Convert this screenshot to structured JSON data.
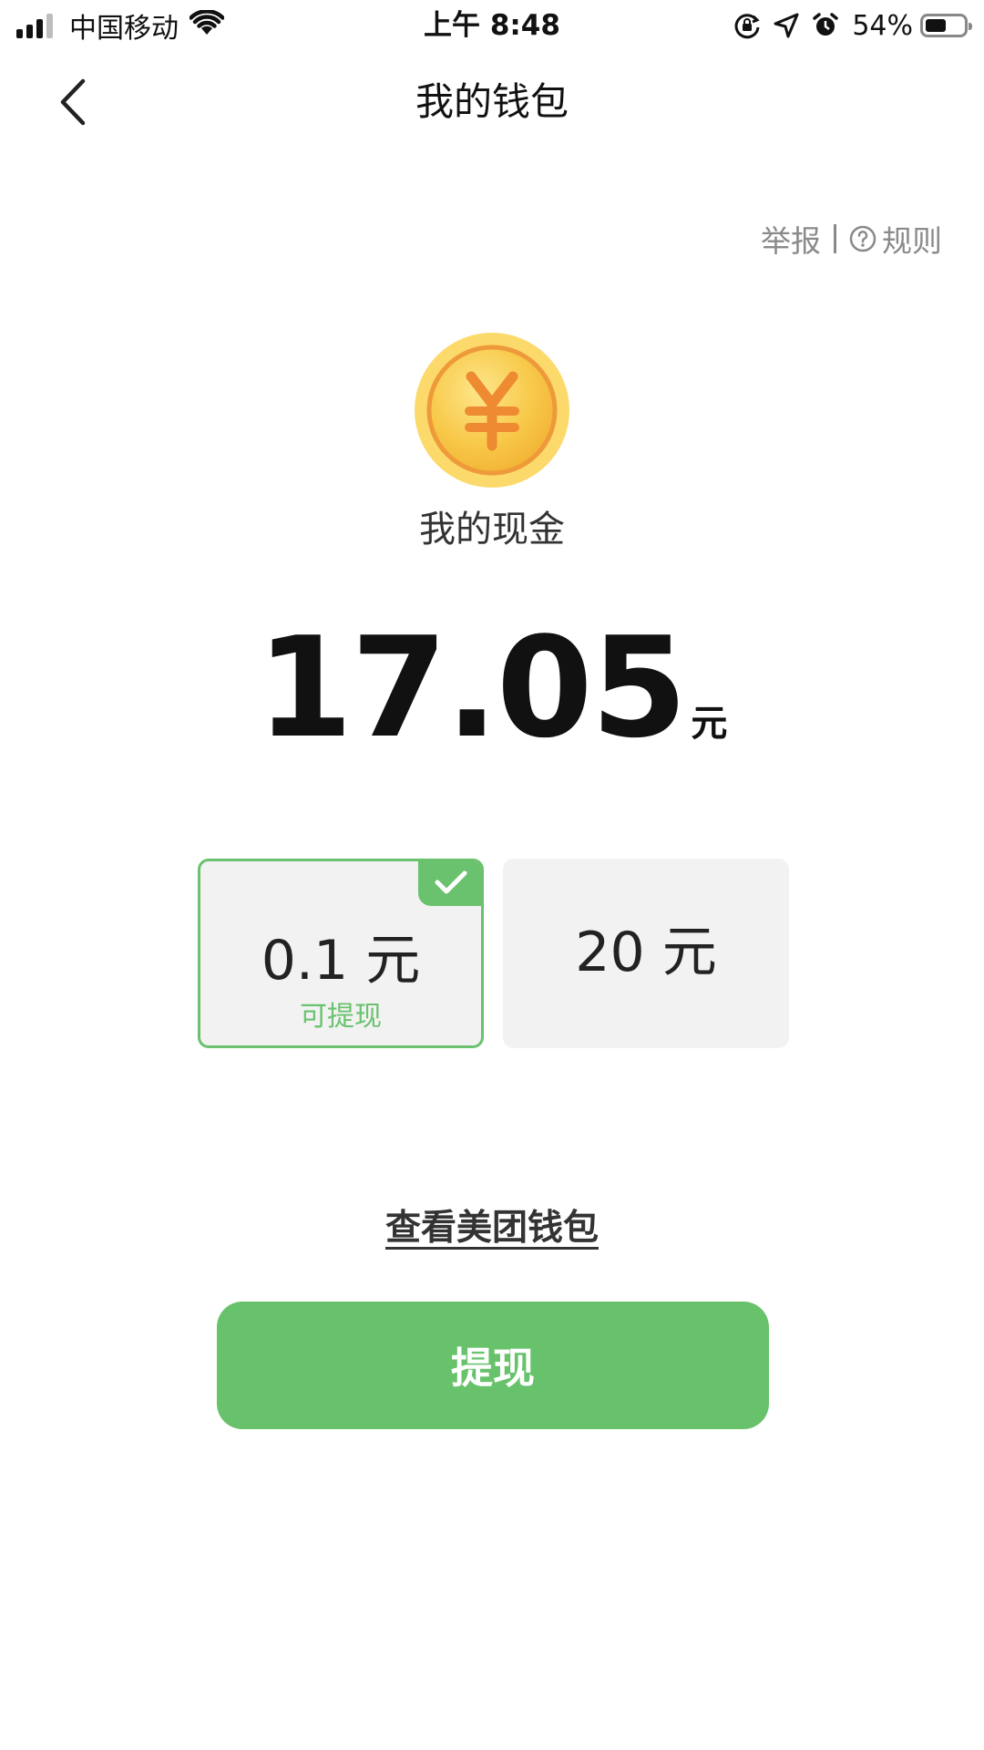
{
  "status_bar": {
    "carrier": "中国移动",
    "time": "上午 8:48",
    "battery_percent": "54%",
    "battery_level": 0.54,
    "icons": [
      "signal-icon",
      "wifi-icon",
      "orientation-lock-icon",
      "location-icon",
      "alarm-icon",
      "battery-icon"
    ]
  },
  "nav": {
    "title": "我的钱包",
    "back_icon": "chevron-left-icon"
  },
  "links": {
    "report": "举报",
    "rules": "规则",
    "help_icon": "question-circle-icon"
  },
  "cash": {
    "coin_icon": "yuan-coin-icon",
    "label": "我的现金",
    "amount": "17.05",
    "unit": "元"
  },
  "options": [
    {
      "amount": "0.1 元",
      "sub": "可提现",
      "selected": true
    },
    {
      "amount": "20 元",
      "sub": "",
      "selected": false
    }
  ],
  "wallet_link": "查看美团钱包",
  "withdraw_button": "提现",
  "colors": {
    "accent_green": "#68c26b",
    "option_bg": "#f2f2f2",
    "coin_gold": "#f6c445",
    "coin_orange": "#ee8a32"
  }
}
